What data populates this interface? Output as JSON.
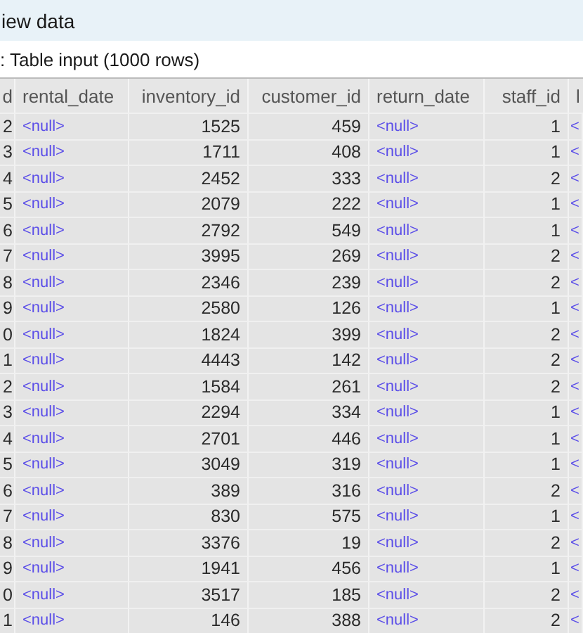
{
  "window": {
    "title": "iew data"
  },
  "subtitle": ": Table input (1000 rows)",
  "table": {
    "columns": [
      {
        "label": "d",
        "kind": "number"
      },
      {
        "label": "rental_date",
        "kind": "null"
      },
      {
        "label": "inventory_id",
        "kind": "number"
      },
      {
        "label": "customer_id",
        "kind": "number"
      },
      {
        "label": "return_date",
        "kind": "null"
      },
      {
        "label": "staff_id",
        "kind": "number"
      },
      {
        "label": "l",
        "kind": "null"
      }
    ],
    "rows": [
      {
        "cells": [
          "2",
          "<null>",
          "1525",
          "459",
          "<null>",
          "1",
          "<"
        ]
      },
      {
        "cells": [
          "3",
          "<null>",
          "1711",
          "408",
          "<null>",
          "1",
          "<"
        ]
      },
      {
        "cells": [
          "4",
          "<null>",
          "2452",
          "333",
          "<null>",
          "2",
          "<"
        ]
      },
      {
        "cells": [
          "5",
          "<null>",
          "2079",
          "222",
          "<null>",
          "1",
          "<"
        ]
      },
      {
        "cells": [
          "6",
          "<null>",
          "2792",
          "549",
          "<null>",
          "1",
          "<"
        ]
      },
      {
        "cells": [
          "7",
          "<null>",
          "3995",
          "269",
          "<null>",
          "2",
          "<"
        ]
      },
      {
        "cells": [
          "8",
          "<null>",
          "2346",
          "239",
          "<null>",
          "2",
          "<"
        ]
      },
      {
        "cells": [
          "9",
          "<null>",
          "2580",
          "126",
          "<null>",
          "1",
          "<"
        ]
      },
      {
        "cells": [
          "0",
          "<null>",
          "1824",
          "399",
          "<null>",
          "2",
          "<"
        ]
      },
      {
        "cells": [
          "1",
          "<null>",
          "4443",
          "142",
          "<null>",
          "2",
          "<"
        ]
      },
      {
        "cells": [
          "2",
          "<null>",
          "1584",
          "261",
          "<null>",
          "2",
          "<"
        ]
      },
      {
        "cells": [
          "3",
          "<null>",
          "2294",
          "334",
          "<null>",
          "1",
          "<"
        ]
      },
      {
        "cells": [
          "4",
          "<null>",
          "2701",
          "446",
          "<null>",
          "1",
          "<"
        ]
      },
      {
        "cells": [
          "5",
          "<null>",
          "3049",
          "319",
          "<null>",
          "1",
          "<"
        ]
      },
      {
        "cells": [
          "6",
          "<null>",
          "389",
          "316",
          "<null>",
          "2",
          "<"
        ]
      },
      {
        "cells": [
          "7",
          "<null>",
          "830",
          "575",
          "<null>",
          "1",
          "<"
        ]
      },
      {
        "cells": [
          "8",
          "<null>",
          "3376",
          "19",
          "<null>",
          "2",
          "<"
        ]
      },
      {
        "cells": [
          "9",
          "<null>",
          "1941",
          "456",
          "<null>",
          "1",
          "<"
        ]
      },
      {
        "cells": [
          "0",
          "<null>",
          "3517",
          "185",
          "<null>",
          "2",
          "<"
        ]
      },
      {
        "cells": [
          "1",
          "<null>",
          "146",
          "388",
          "<null>",
          "2",
          "<"
        ]
      }
    ]
  }
}
